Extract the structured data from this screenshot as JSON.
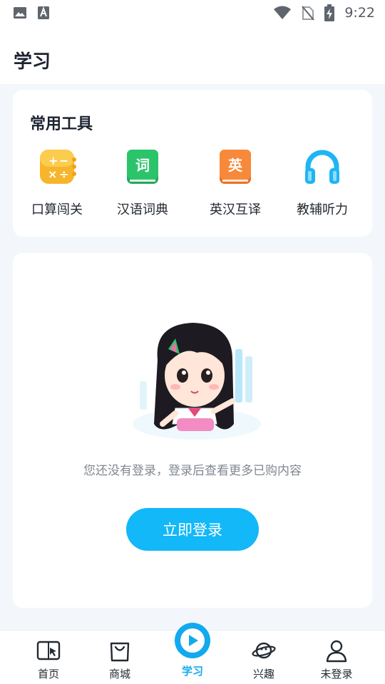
{
  "status_bar": {
    "time": "9:22",
    "icons": [
      "image-icon",
      "text-a-icon",
      "wifi-icon",
      "no-sim-icon",
      "battery-charging-icon"
    ]
  },
  "header": {
    "title": "学习"
  },
  "tools": {
    "title": "常用工具",
    "items": [
      {
        "label": "口算闯关",
        "icon": "calculator-icon",
        "color": "#f7b52c"
      },
      {
        "label": "汉语词典",
        "icon": "dictionary-icon",
        "color": "#2bc46b"
      },
      {
        "label": "英汉互译",
        "icon": "translate-icon",
        "color": "#f7893b"
      },
      {
        "label": "教辅听力",
        "icon": "headphones-icon",
        "color": "#1fb5f3"
      }
    ]
  },
  "login": {
    "tip": "您还没有登录，登录后查看更多已购内容",
    "button_label": "立即登录",
    "illustration": "girl-character-illustration"
  },
  "tabbar": {
    "active_color": "#12a9ee",
    "items": [
      {
        "label": "首页",
        "icon": "home-book-icon"
      },
      {
        "label": "商城",
        "icon": "shopping-bag-icon"
      },
      {
        "label": "学习",
        "icon": "study-play-icon",
        "active": true
      },
      {
        "label": "兴趣",
        "icon": "planet-icon"
      },
      {
        "label": "未登录",
        "icon": "user-icon"
      }
    ]
  }
}
